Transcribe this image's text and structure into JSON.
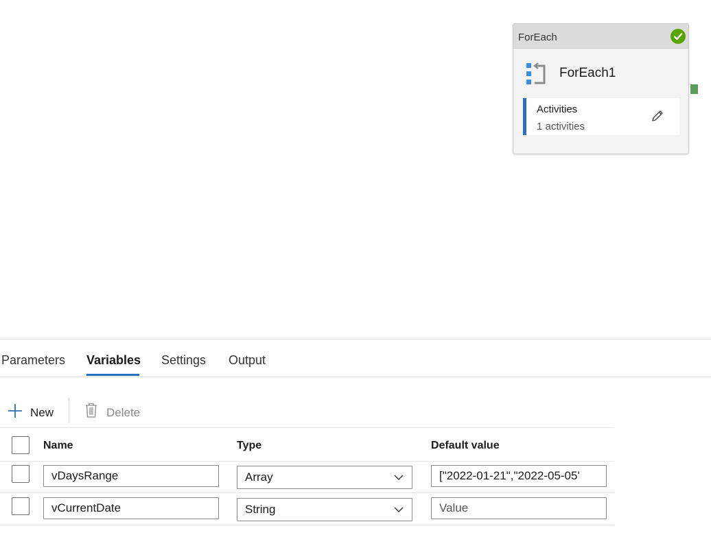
{
  "activity": {
    "type_label": "ForEach",
    "name": "ForEach1",
    "activities_title": "Activities",
    "activities_count": "1 activities",
    "status_color": "#57a300",
    "connector_color": "#5d9a5b"
  },
  "tabs": [
    {
      "label": "Parameters",
      "active": false
    },
    {
      "label": "Variables",
      "active": true
    },
    {
      "label": "Settings",
      "active": false
    },
    {
      "label": "Output",
      "active": false
    }
  ],
  "toolbar": {
    "new_label": "New",
    "delete_label": "Delete"
  },
  "table": {
    "headers": {
      "name": "Name",
      "type": "Type",
      "default_value": "Default value"
    },
    "rows": [
      {
        "name": "vDaysRange",
        "type": "Array",
        "default_value": "[\"2022-01-21\",\"2022-05-05'",
        "default_placeholder": ""
      },
      {
        "name": "vCurrentDate",
        "type": "String",
        "default_value": "",
        "default_placeholder": "Value"
      }
    ]
  },
  "accent_color": "#2c6fbd"
}
